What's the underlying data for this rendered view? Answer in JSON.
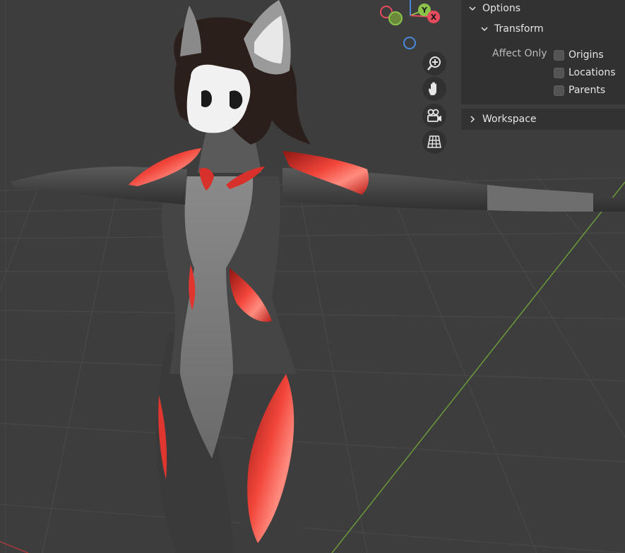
{
  "gizmo": {
    "axis_y": "Y",
    "axis_x": "X",
    "colors": {
      "x": "#e54b5c",
      "y": "#8bc34a",
      "z": "#4a88d9"
    }
  },
  "navigation": {
    "zoom_icon": "zoom-icon",
    "pan_icon": "hand-pan-icon",
    "camera_icon": "camera-view-icon",
    "ortho_icon": "perspective-grid-icon"
  },
  "options": {
    "title": "Options",
    "transform": {
      "title": "Transform",
      "affect_only_label": "Affect Only",
      "checkboxes": [
        {
          "label": "Origins",
          "checked": false
        },
        {
          "label": "Locations",
          "checked": false
        },
        {
          "label": "Parents",
          "checked": false
        }
      ]
    },
    "workspace_title": "Workspace"
  },
  "colors": {
    "background": "#3d3d3d",
    "grid_line": "#4a4a4a",
    "x_axis_line": "#6a9a3a",
    "body_dark": "#3f3f3f",
    "body_light": "#7d7d7d",
    "accent_red": "#d8302a",
    "hair": "#2a1f1a",
    "mask": "#f1f1f1"
  }
}
